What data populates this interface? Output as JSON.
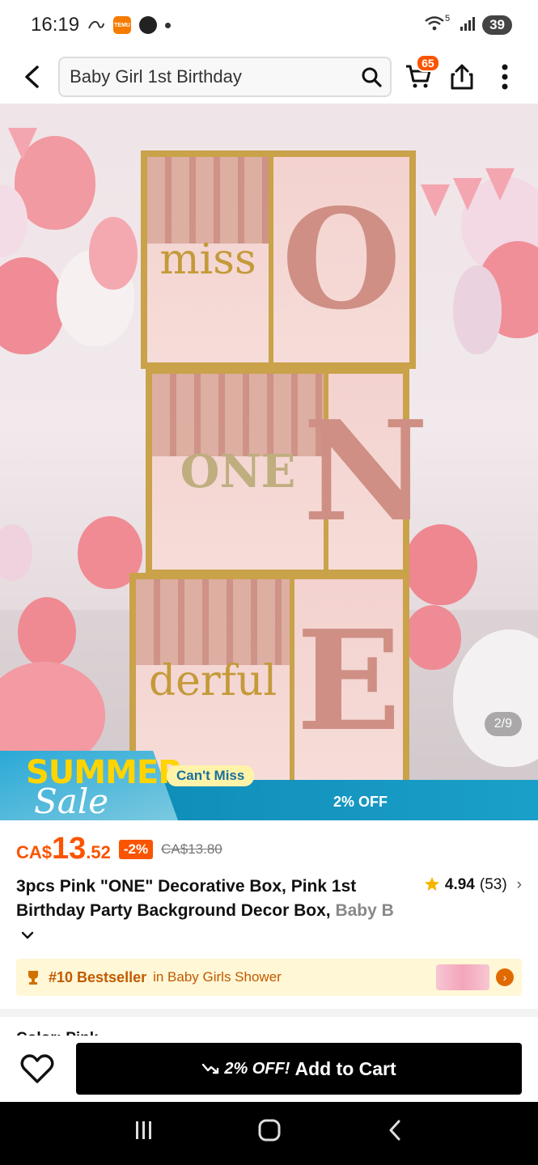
{
  "status_bar": {
    "time": "16:19",
    "battery": "39",
    "signal_label": "5"
  },
  "top_bar": {
    "search_query": "Baby Girl 1st Birthday",
    "cart_count": "65"
  },
  "hero": {
    "box_words": [
      "miss",
      "ONE",
      "derful"
    ],
    "box_letters": [
      "O",
      "N",
      "E"
    ],
    "page_indicator": "2/9",
    "sale_title": "SUMMER",
    "sale_script": "Sale",
    "cant_miss": "Can't Miss",
    "off_text": "2% OFF"
  },
  "price": {
    "currency": "CA$",
    "integer": "13",
    "decimal": ".52",
    "discount": "-2%",
    "original": "CA$13.80"
  },
  "product": {
    "title_main": "3pcs Pink \"ONE\" Decorative Box, Pink 1st Birthday Party Background Decor Box, ",
    "title_fade": "Baby B",
    "rating": "4.94",
    "reviews": "(53)"
  },
  "bestseller": {
    "rank": "#10 Bestseller",
    "category": "in Baby Girls Shower"
  },
  "color_row": {
    "label": "Color: Pink"
  },
  "cart_bar": {
    "offer": "2% OFF!",
    "button": "Add to Cart"
  },
  "colors": {
    "accent": "#fb5400",
    "sale_blue": "#0c86b4",
    "bestseller_bg": "#fff7d6"
  }
}
